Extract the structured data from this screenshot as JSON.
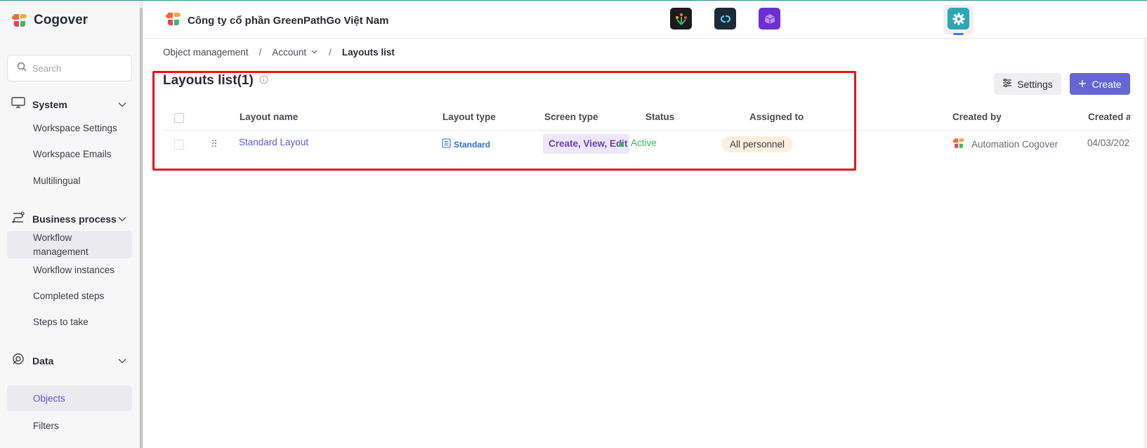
{
  "sidebar": {
    "brand": "Cogover",
    "search_placeholder": "Search",
    "sections": [
      {
        "label": "System",
        "items": [
          "Workspace Settings",
          "Workspace Emails",
          "Multilingual"
        ]
      },
      {
        "label": "Business process",
        "items": [
          "Workflow management",
          "Workflow instances",
          "Completed steps",
          "Steps to take"
        ]
      },
      {
        "label": "Data",
        "items": [
          "Objects",
          "Filters"
        ]
      }
    ],
    "active_item": "Objects"
  },
  "header": {
    "company": "Công ty cổ phần GreenPathGo Việt Nam",
    "apps": [
      "people-app-icon",
      "link-app-icon",
      "box-app-icon",
      "settings-app-icon"
    ],
    "active_app": "settings-app-icon"
  },
  "breadcrumb": {
    "items": [
      "Object management",
      "Account",
      "Layouts list"
    ],
    "separator": "/"
  },
  "page": {
    "title": "Layouts list(1)",
    "settings_label": "Settings",
    "create_label": "Create"
  },
  "table": {
    "columns": [
      "Layout name",
      "Layout type",
      "Screen type",
      "Status",
      "Assigned to",
      "Created by",
      "Created a"
    ],
    "rows": [
      {
        "layout_name": "Standard Layout",
        "layout_type": "Standard",
        "screen_type": "Create, View, Edit",
        "status": "Active",
        "assigned_to": "All personnel",
        "created_by": "Automation Cogover",
        "created_at": "04/03/202"
      }
    ]
  },
  "colors": {
    "accent": "#6367cf",
    "link": "#5b5bc7",
    "status_active": "#3bb55a",
    "highlight_box": "#e8141a",
    "screen_badge_bg": "#efe7fb",
    "assigned_badge_bg": "#fdf0e0"
  }
}
